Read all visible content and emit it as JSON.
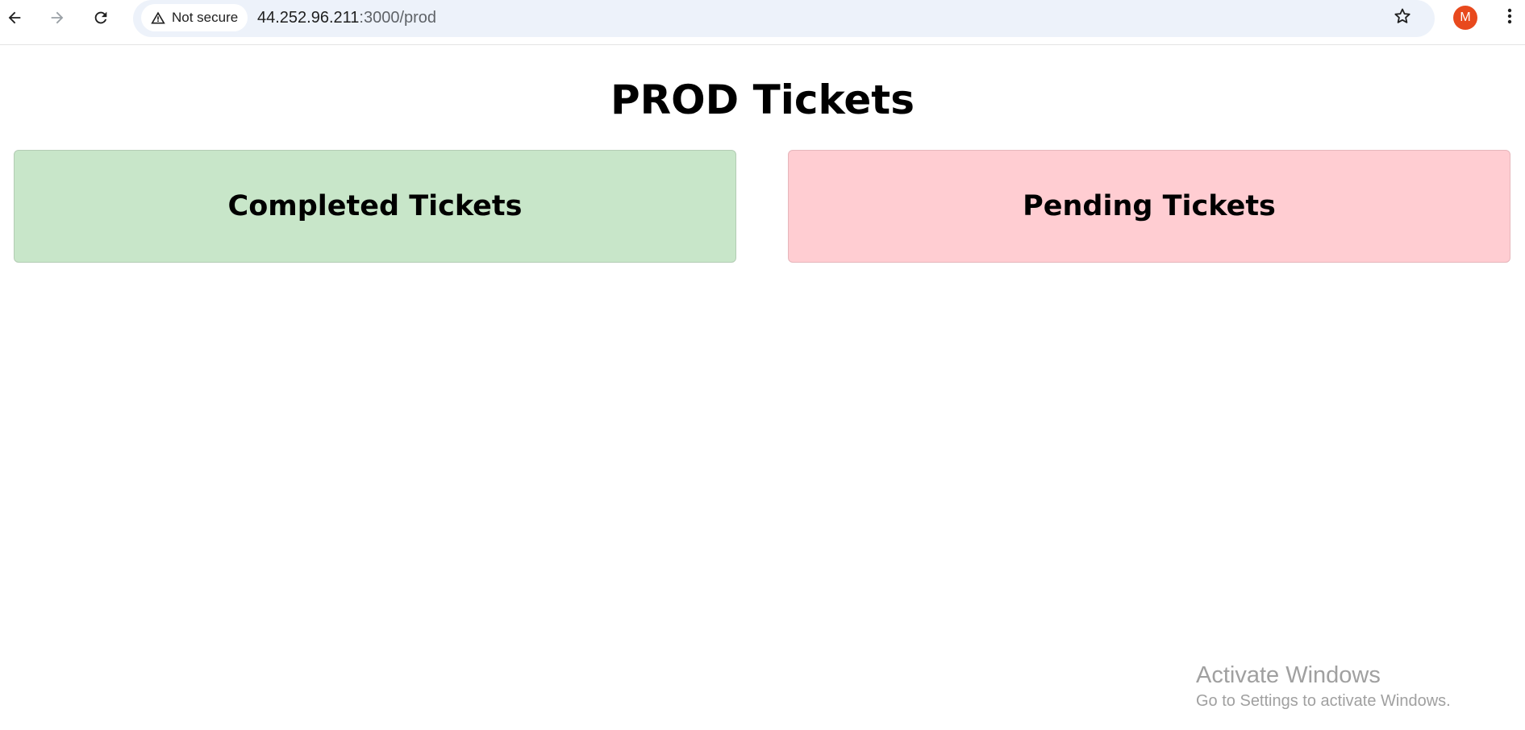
{
  "browser": {
    "security_chip": {
      "label": "Not secure",
      "icon": "warning-triangle-icon"
    },
    "url": {
      "host": "44.252.96.211",
      "path": ":3000/prod"
    },
    "profile_initial": "M",
    "colors": {
      "omnibox_bg": "#edf2fa",
      "avatar": "#e8491d"
    }
  },
  "page": {
    "title": "PROD Tickets",
    "cards": [
      {
        "label": "Completed Tickets",
        "color": "#c8e6c9"
      },
      {
        "label": "Pending Tickets",
        "color": "#ffcdd2"
      }
    ]
  },
  "watermark": {
    "title": "Activate Windows",
    "subtitle": "Go to Settings to activate Windows."
  }
}
